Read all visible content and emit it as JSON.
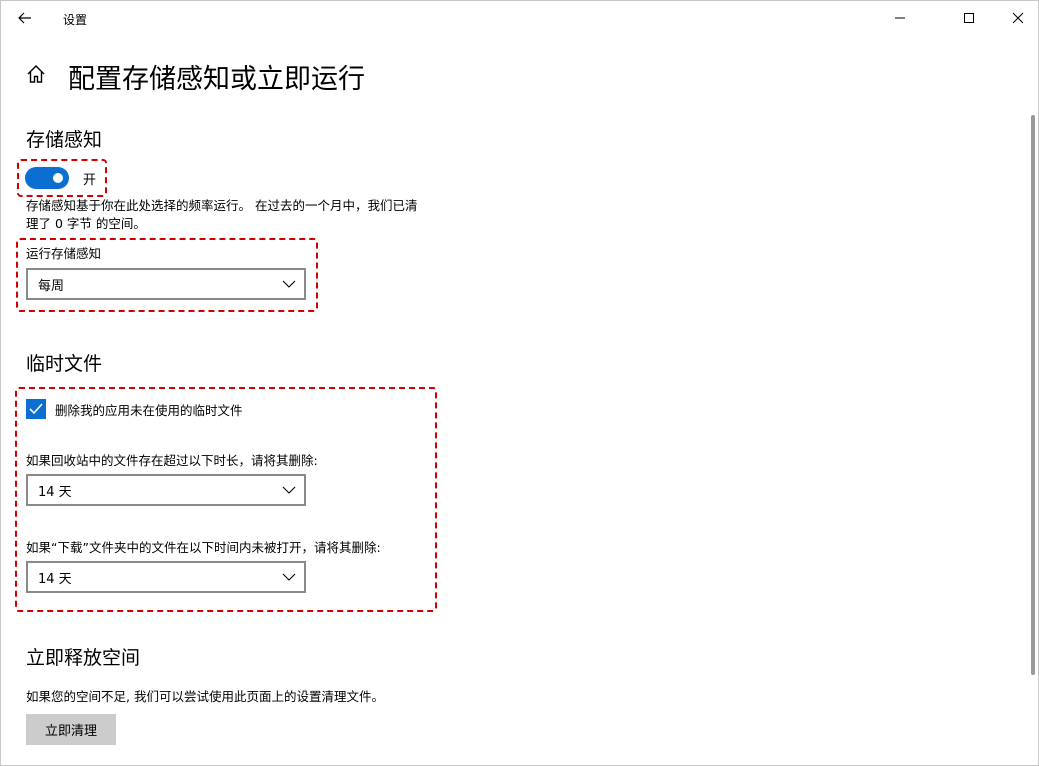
{
  "window": {
    "title": "设置",
    "icons": {
      "back": "back-arrow-icon",
      "minimize": "minimize-icon",
      "maximize": "maximize-icon",
      "close": "close-icon"
    }
  },
  "header": {
    "title": "配置存储感知或立即运行",
    "icon": "home-icon"
  },
  "storage_sense": {
    "section_title": "存储感知",
    "toggle_label": "开",
    "toggle_on": true,
    "accent_color": "#0a6fd1",
    "description_line1": "存储感知基于你在此处选择的频率运行。 在过去的一个月中，我们已清",
    "description_line2": "理了 0 字节 的空间。",
    "run_label": "运行存储感知",
    "run_value": "每周"
  },
  "temp_files": {
    "section_title": "临时文件",
    "checkbox_label": "删除我的应用未在使用的临时文件",
    "checkbox_checked": true,
    "recycle_label": "如果回收站中的文件存在超过以下时长，请将其删除:",
    "recycle_value": "14 天",
    "downloads_label": "如果“下载”文件夹中的文件在以下时间内未被打开，请将其删除:",
    "downloads_value": "14 天"
  },
  "free_space": {
    "section_title": "立即释放空间",
    "description": "如果您的空间不足, 我们可以尝试使用此页面上的设置清理文件。",
    "button_label": "立即清理"
  },
  "highlight_color": "#d40000"
}
